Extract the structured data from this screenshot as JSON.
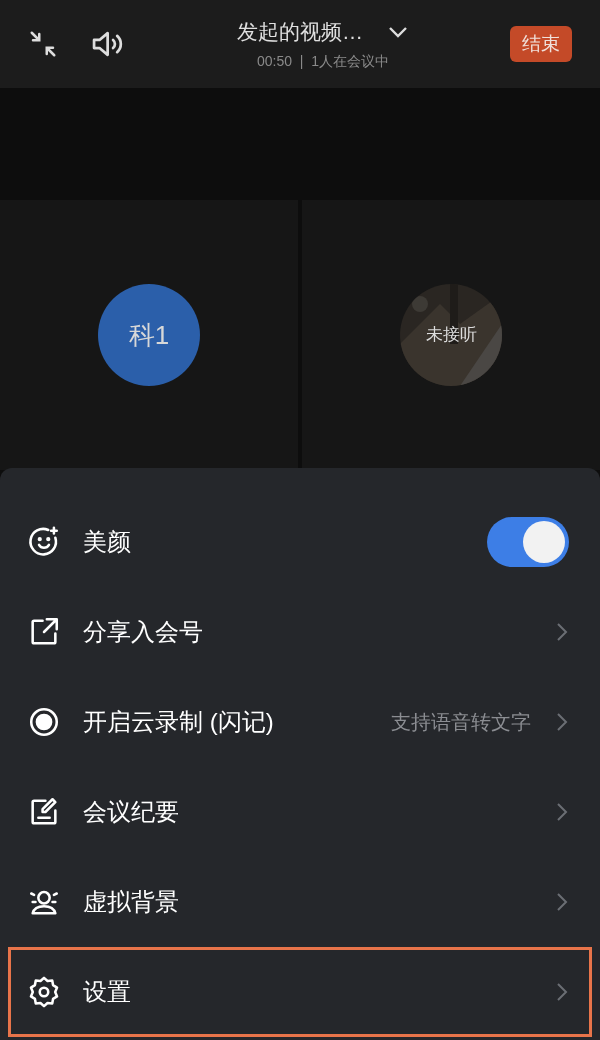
{
  "top_bar": {
    "title": "发起的视频…",
    "status": "00:50  |  1人在会议中",
    "end_button": "结束"
  },
  "tiles": [
    {
      "kind": "initials",
      "avatar_text": "科1"
    },
    {
      "avatar_text": "未接听"
    }
  ],
  "menu": [
    {
      "kind": "toggle",
      "label": "美颜",
      "on": true,
      "highlighted": false
    },
    {
      "kind": "link",
      "label": "分享入会号",
      "highlighted": false
    },
    {
      "kind": "link",
      "label": "开启云录制 (闪记)",
      "hint": "支持语音转文字",
      "highlighted": false
    },
    {
      "kind": "link",
      "label": "会议纪要",
      "highlighted": false
    },
    {
      "kind": "link",
      "label": "虚拟背景",
      "highlighted": false
    },
    {
      "kind": "link",
      "label": "设置",
      "highlighted": true
    }
  ]
}
